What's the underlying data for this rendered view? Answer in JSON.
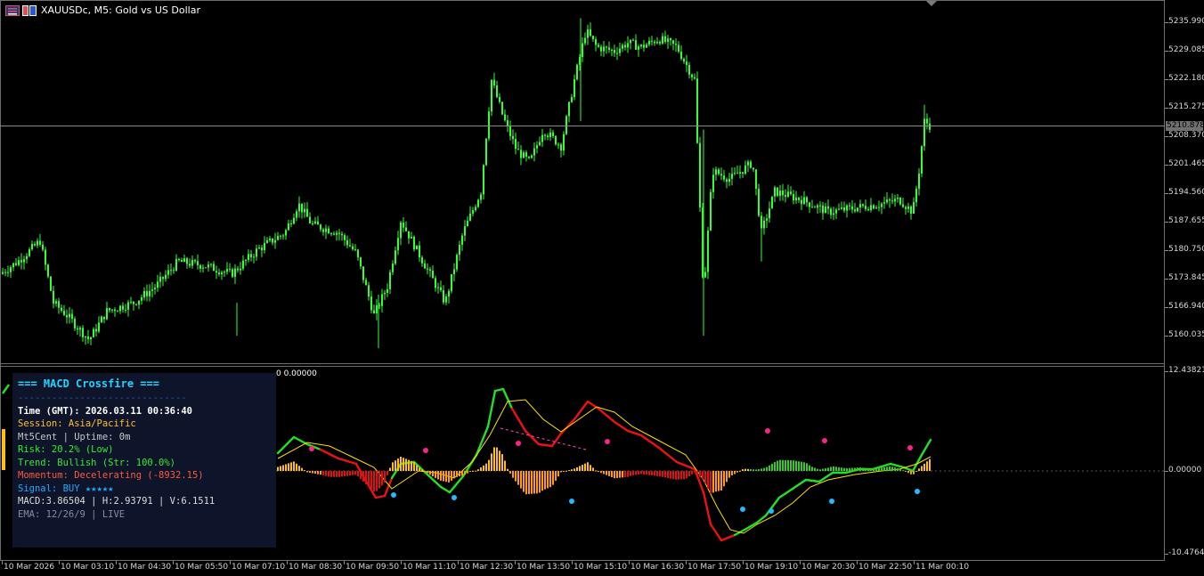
{
  "window": {
    "title": "XAUUSDc, M5:  Gold vs US Dollar",
    "indicator_value": "0 0.00000"
  },
  "colors": {
    "background": "#000000",
    "candle": "#33ff33",
    "macd_line_bull": "#22e022",
    "macd_line_bear": "#ee1111",
    "signal_line": "#ffe000",
    "hist_pos_bull": "#ffbe14",
    "hist_pos_green": "#33cc22",
    "hist_neg_orange": "#ff9b10",
    "hist_neg_red": "#dd1111",
    "dot_magenta": "#ff2288",
    "dot_cyan": "#22bbff",
    "panel_bg": "#0e1429"
  },
  "price_axis": {
    "labels": [
      "5235.990",
      "5229.085",
      "5222.180",
      "5215.275",
      "5208.370",
      "5201.465",
      "5194.560",
      "5187.655",
      "5180.750",
      "5173.845",
      "5166.940",
      "5160.035"
    ],
    "current_price": "5210.878"
  },
  "indicator_axis": {
    "labels": [
      "12.43821",
      "0.00000",
      "-10.47649"
    ]
  },
  "time_axis": {
    "labels": [
      "10 Mar 2026",
      "10 Mar 03:10",
      "10 Mar 04:30",
      "10 Mar 05:50",
      "10 Mar 07:10",
      "10 Mar 08:30",
      "10 Mar 09:50",
      "10 Mar 11:10",
      "10 Mar 12:30",
      "10 Mar 13:50",
      "10 Mar 15:10",
      "10 Mar 16:30",
      "10 Mar 17:50",
      "10 Mar 19:10",
      "10 Mar 20:30",
      "10 Mar 22:50",
      "11 Mar 00:10"
    ]
  },
  "panel": {
    "title": "=== MACD Crossfire ===",
    "divider": "------------------------------",
    "time": "Time (GMT): 2026.03.11 00:36:40",
    "session": "Session: Asia/Pacific",
    "account": "Mt5Cent  |  Uptime: 0m",
    "risk": "Risk: 20.2% (Low)",
    "trend": "Trend: Bullish (Str: 100.0%)",
    "momentum": "Momentum: Decelerating (-8932.15)",
    "signal": "Signal: BUY ★★★★★",
    "macd": "MACD:3.86504 | H:2.93791 | V:6.1511",
    "ema": "EMA: 12/26/9  |  LIVE"
  }
}
